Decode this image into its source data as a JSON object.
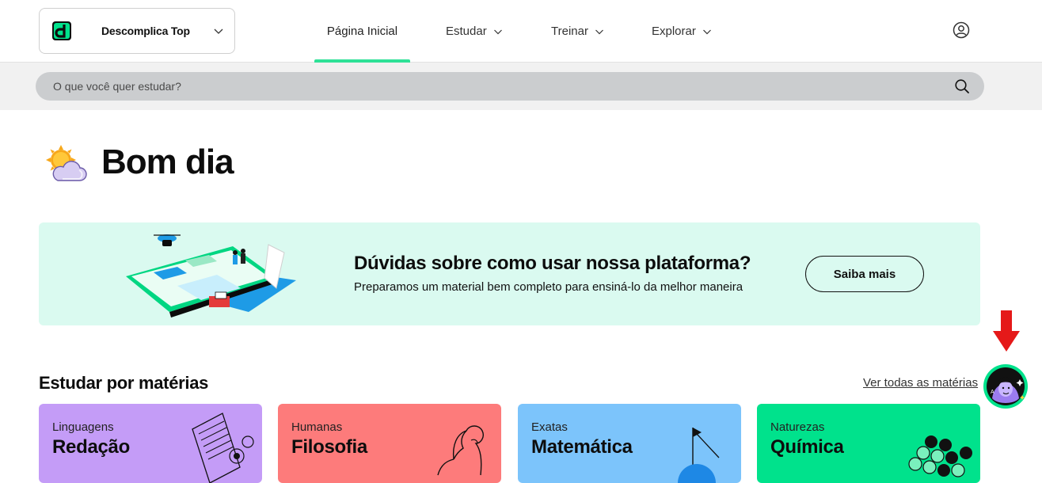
{
  "header": {
    "plan_name": "Descomplica Top",
    "logo_letter": "d",
    "nav": [
      {
        "label": "Página Inicial",
        "active": true
      },
      {
        "label": "Estudar",
        "has_dropdown": true
      },
      {
        "label": "Treinar",
        "has_dropdown": true
      },
      {
        "label": "Explorar",
        "has_dropdown": true
      }
    ],
    "account_icon": "user-circle-icon"
  },
  "search": {
    "placeholder": "O que você quer estudar?",
    "icon": "search-icon"
  },
  "greeting": {
    "text": "Bom dia",
    "icon": "sun-behind-cloud-icon"
  },
  "banner": {
    "title": "Dúvidas sobre como usar nossa plataforma?",
    "subtitle": "Preparamos um material bem completo para ensiná-lo da melhor maneira",
    "button_label": "Saiba mais"
  },
  "subjects": {
    "title": "Estudar por matérias",
    "see_all": "Ver todas as matérias",
    "cards": [
      {
        "category": "Linguagens",
        "subject": "Redação",
        "color": "#c49cf7"
      },
      {
        "category": "Humanas",
        "subject": "Filosofia",
        "color": "#fd7b7b"
      },
      {
        "category": "Exatas",
        "subject": "Matemática",
        "color": "#7cc4fb"
      },
      {
        "category": "Naturezas",
        "subject": "Química",
        "color": "#00e28c"
      }
    ]
  },
  "colors": {
    "accent": "#2ee197",
    "banner_bg": "#dafaf0",
    "search_bg": "#cbcdcf"
  }
}
